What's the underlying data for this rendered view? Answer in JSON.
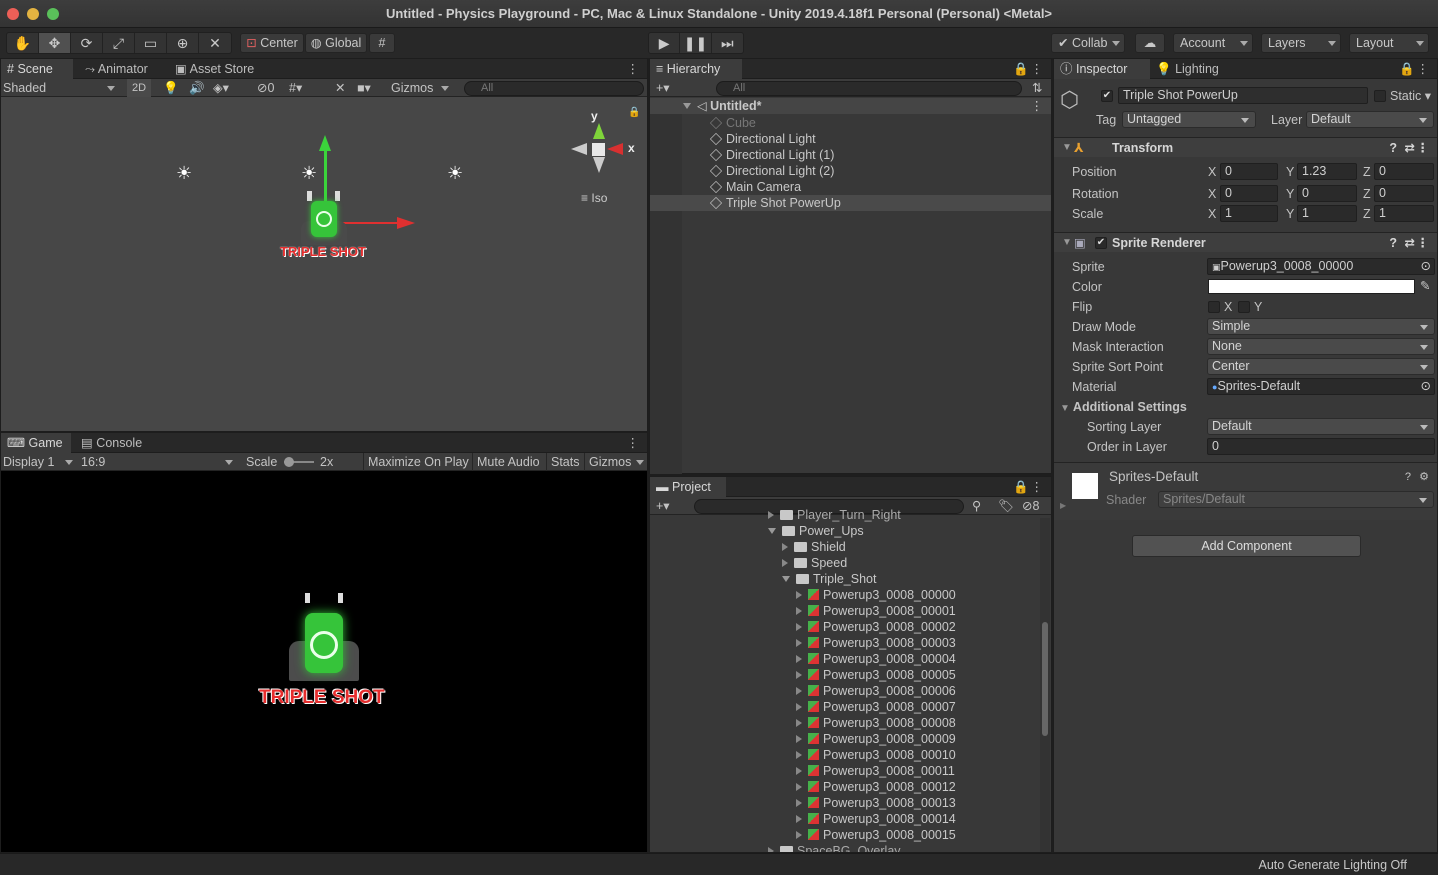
{
  "window": {
    "title": "Untitled - Physics Playground - PC, Mac & Linux Standalone - Unity 2019.4.18f1 Personal (Personal) <Metal>"
  },
  "toolbar": {
    "pivot": "Center",
    "space": "Global",
    "collab": "Collab",
    "account": "Account",
    "layers": "Layers",
    "layout": "Layout"
  },
  "scene": {
    "tabs": [
      "Scene",
      "Animator",
      "Asset Store"
    ],
    "shading": "Shaded",
    "mode2d": "2D",
    "hidden_count": "0",
    "gizmos": "Gizmos",
    "search_placeholder": "All",
    "axis_y": "y",
    "axis_x": "x",
    "iso": "Iso",
    "sprite_label": "TRIPLE SHOT"
  },
  "game": {
    "tabs": [
      "Game",
      "Console"
    ],
    "display": "Display 1",
    "aspect": "16:9",
    "scale_label": "Scale",
    "scale_value": "2x",
    "maximize": "Maximize On Play",
    "mute": "Mute Audio",
    "stats": "Stats",
    "gizmos": "Gizmos",
    "sprite_label": "TRIPLE SHOT"
  },
  "hierarchy": {
    "tab": "Hierarchy",
    "search_placeholder": "All",
    "scene_name": "Untitled*",
    "items": [
      "Cube",
      "Directional Light",
      "Directional Light (1)",
      "Directional Light (2)",
      "Main Camera",
      "Triple Shot PowerUp"
    ]
  },
  "project": {
    "tab": "Project",
    "hidden_count": "8",
    "top_cut": "Player_Turn_Right",
    "folders": [
      {
        "name": "Power_Ups",
        "depth": 0,
        "open": true
      },
      {
        "name": "Shield",
        "depth": 1,
        "open": false
      },
      {
        "name": "Speed",
        "depth": 1,
        "open": false
      },
      {
        "name": "Triple_Shot",
        "depth": 1,
        "open": true
      }
    ],
    "sprites": [
      "Powerup3_0008_00000",
      "Powerup3_0008_00001",
      "Powerup3_0008_00002",
      "Powerup3_0008_00003",
      "Powerup3_0008_00004",
      "Powerup3_0008_00005",
      "Powerup3_0008_00006",
      "Powerup3_0008_00007",
      "Powerup3_0008_00008",
      "Powerup3_0008_00009",
      "Powerup3_0008_00010",
      "Powerup3_0008_00011",
      "Powerup3_0008_00012",
      "Powerup3_0008_00013",
      "Powerup3_0008_00014",
      "Powerup3_0008_00015"
    ],
    "bottom_cut": "SpaceBG_Overlay"
  },
  "inspector": {
    "tabs": [
      "Inspector",
      "Lighting"
    ],
    "object_name": "Triple Shot PowerUp",
    "static": "Static",
    "tag_label": "Tag",
    "tag": "Untagged",
    "layer_label": "Layer",
    "layer": "Default",
    "transform": {
      "title": "Transform",
      "position_label": "Position",
      "rotation_label": "Rotation",
      "scale_label": "Scale",
      "position": [
        "0",
        "1.23",
        "0"
      ],
      "rotation": [
        "0",
        "0",
        "0"
      ],
      "scale": [
        "1",
        "1",
        "1"
      ],
      "axes": [
        "X",
        "Y",
        "Z"
      ]
    },
    "sprite_renderer": {
      "title": "Sprite Renderer",
      "sprite_label": "Sprite",
      "sprite": "Powerup3_0008_00000",
      "color_label": "Color",
      "color": "#ffffff",
      "flip_label": "Flip",
      "flip_x": "X",
      "flip_y": "Y",
      "draw_mode_label": "Draw Mode",
      "draw_mode": "Simple",
      "mask_label": "Mask Interaction",
      "mask": "None",
      "sort_point_label": "Sprite Sort Point",
      "sort_point": "Center",
      "material_label": "Material",
      "material": "Sprites-Default",
      "additional": "Additional Settings",
      "sorting_layer_label": "Sorting Layer",
      "sorting_layer": "Default",
      "order_label": "Order in Layer",
      "order": "0"
    },
    "material": {
      "name": "Sprites-Default",
      "shader_label": "Shader",
      "shader": "Sprites/Default"
    },
    "add_component": "Add Component"
  },
  "status": {
    "text": "Auto Generate Lighting Off"
  },
  "colors": {
    "panel": "#383838",
    "accent_green": "#38c43c",
    "accent_red": "#d93030"
  }
}
